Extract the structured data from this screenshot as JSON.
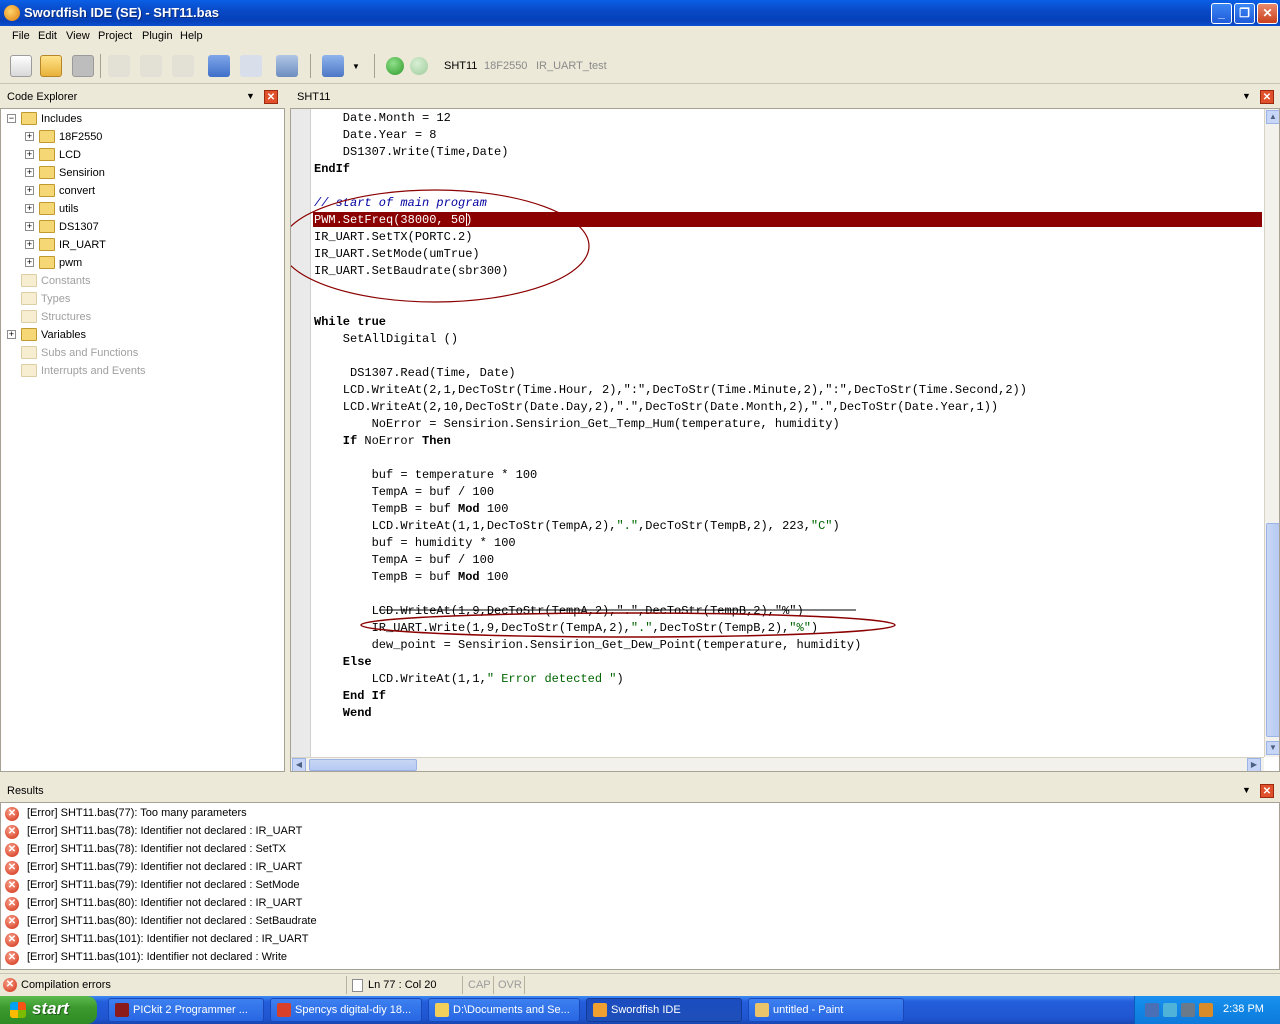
{
  "window": {
    "title": "Swordfish IDE (SE) - SHT11.bas"
  },
  "menu": [
    "File",
    "Edit",
    "View",
    "Project",
    "Plugin",
    "Help"
  ],
  "toolbar": {
    "tabs": [
      "SHT11",
      "18F2550",
      "IR_UART_test"
    ]
  },
  "explorer": {
    "title": "Code Explorer",
    "items": [
      {
        "label": "Includes",
        "level": 0,
        "expand": "−",
        "dim": false
      },
      {
        "label": "18F2550",
        "level": 1,
        "expand": "+",
        "dim": false
      },
      {
        "label": "LCD",
        "level": 1,
        "expand": "+",
        "dim": false
      },
      {
        "label": "Sensirion",
        "level": 1,
        "expand": "+",
        "dim": false
      },
      {
        "label": "convert",
        "level": 1,
        "expand": "+",
        "dim": false
      },
      {
        "label": "utils",
        "level": 1,
        "expand": "+",
        "dim": false
      },
      {
        "label": "DS1307",
        "level": 1,
        "expand": "+",
        "dim": false
      },
      {
        "label": "IR_UART",
        "level": 1,
        "expand": "+",
        "dim": false
      },
      {
        "label": "pwm",
        "level": 1,
        "expand": "+",
        "dim": false
      },
      {
        "label": "Constants",
        "level": 0,
        "expand": "",
        "dim": true
      },
      {
        "label": "Types",
        "level": 0,
        "expand": "",
        "dim": true
      },
      {
        "label": "Structures",
        "level": 0,
        "expand": "",
        "dim": true
      },
      {
        "label": "Variables",
        "level": 0,
        "expand": "+",
        "dim": false
      },
      {
        "label": "Subs and Functions",
        "level": 0,
        "expand": "",
        "dim": true
      },
      {
        "label": "Interrupts and Events",
        "level": 0,
        "expand": "",
        "dim": true
      }
    ]
  },
  "editor": {
    "tab": "SHT11",
    "lines": [
      [
        {
          "t": "    Date.Month = 12"
        }
      ],
      [
        {
          "t": "    Date.Year = 8"
        }
      ],
      [
        {
          "t": "    DS1307.Write(Time,Date)"
        }
      ],
      [
        {
          "t": "EndIf",
          "c": "kw"
        }
      ],
      [
        {
          "t": ""
        }
      ],
      [
        {
          "t": "// start of main program",
          "c": "cm"
        }
      ],
      [
        {
          "t": "PWM.SetFreq(38000, 50)",
          "c": "hl-text"
        }
      ],
      [
        {
          "t": "IR_UART.SetTX(PORTC.2)"
        }
      ],
      [
        {
          "t": "IR_UART.SetMode(umTrue)"
        }
      ],
      [
        {
          "t": "IR_UART.SetBaudrate(sbr300)"
        }
      ],
      [
        {
          "t": ""
        }
      ],
      [
        {
          "t": ""
        }
      ],
      [
        {
          "t": "While true",
          "c": "kw"
        }
      ],
      [
        {
          "t": "    SetAllDigital ()"
        }
      ],
      [
        {
          "t": ""
        }
      ],
      [
        {
          "t": "     DS1307.Read(Time, Date)"
        }
      ],
      [
        {
          "t": "    LCD.WriteAt(2,1,DecToStr(Time.Hour, 2),\":\",DecToStr(Time.Minute,2),\":\",DecToStr(Time.Second,2))"
        }
      ],
      [
        {
          "t": "    LCD.WriteAt(2,10,DecToStr(Date.Day,2),\".\",DecToStr(Date.Month,2),\".\",DecToStr(Date.Year,1))"
        }
      ],
      [
        {
          "t": "        NoError = Sensirion.Sensirion_Get_Temp_Hum(temperature, humidity)"
        }
      ],
      [
        {
          "t": "    If ",
          "c": "kw"
        },
        {
          "t": "NoError "
        },
        {
          "t": "Then",
          "c": "kw"
        }
      ],
      [
        {
          "t": ""
        }
      ],
      [
        {
          "t": "        buf = temperature * 100"
        }
      ],
      [
        {
          "t": "        TempA = buf / 100"
        }
      ],
      [
        {
          "t": "        TempB = buf "
        },
        {
          "t": "Mod",
          "c": "kw"
        },
        {
          "t": " 100"
        }
      ],
      [
        {
          "t": "        LCD.WriteAt(1,1,DecToStr(TempA,2),"
        },
        {
          "t": "\".\"",
          "c": "st"
        },
        {
          "t": ",DecToStr(TempB,2), 223,"
        },
        {
          "t": "\"C\"",
          "c": "st"
        },
        {
          "t": ")"
        }
      ],
      [
        {
          "t": "        buf = humidity * 100"
        }
      ],
      [
        {
          "t": "        TempA = buf / 100"
        }
      ],
      [
        {
          "t": "        TempB = buf "
        },
        {
          "t": "Mod",
          "c": "kw"
        },
        {
          "t": " 100"
        }
      ],
      [
        {
          "t": ""
        }
      ],
      [
        {
          "t": "        LCD.WriteAt(1,9,DecToStr(TempA,2),\".\",DecToStr(TempB,2),\"%\")"
        }
      ],
      [
        {
          "t": "        IR_UART.Write(1,9,DecToStr(TempA,2),"
        },
        {
          "t": "\".\"",
          "c": "st"
        },
        {
          "t": ",DecToStr(TempB,2),"
        },
        {
          "t": "\"%\"",
          "c": "st"
        },
        {
          "t": ")"
        }
      ],
      [
        {
          "t": "        dew_point = Sensirion.Sensirion_Get_Dew_Point(temperature, humidity)"
        }
      ],
      [
        {
          "t": "    Else",
          "c": "kw"
        }
      ],
      [
        {
          "t": "        LCD.WriteAt(1,1,"
        },
        {
          "t": "\" Error detected \"",
          "c": "st"
        },
        {
          "t": ")"
        }
      ],
      [
        {
          "t": "    End If",
          "c": "kw"
        }
      ],
      [
        {
          "t": "    Wend",
          "c": "kw"
        }
      ]
    ]
  },
  "results": {
    "title": "Results",
    "errors": [
      "[Error] SHT11.bas(77): Too many parameters",
      "[Error] SHT11.bas(78): Identifier not declared : IR_UART",
      "[Error] SHT11.bas(78): Identifier not declared : SetTX",
      "[Error] SHT11.bas(79): Identifier not declared : IR_UART",
      "[Error] SHT11.bas(79): Identifier not declared : SetMode",
      "[Error] SHT11.bas(80): Identifier not declared : IR_UART",
      "[Error] SHT11.bas(80): Identifier not declared : SetBaudrate",
      "[Error] SHT11.bas(101): Identifier not declared : IR_UART",
      "[Error] SHT11.bas(101): Identifier not declared : Write"
    ]
  },
  "status": {
    "message": "Compilation errors",
    "position": "Ln 77 : Col 20",
    "cap": "CAP",
    "ovr": "OVR"
  },
  "taskbar": {
    "start": "start",
    "tasks": [
      {
        "label": "PICkit 2 Programmer ...",
        "color": "#8B1A1A",
        "active": false
      },
      {
        "label": "Spencys digital-diy 18...",
        "color": "#D8402A",
        "active": false
      },
      {
        "label": "D:\\Documents and Se...",
        "color": "#F2CF5B",
        "active": false
      },
      {
        "label": "Swordfish IDE",
        "color": "#F0A030",
        "active": true
      },
      {
        "label": "untitled - Paint",
        "color": "#E9C46A",
        "active": false
      }
    ],
    "clock": "2:38 PM"
  },
  "colors": {
    "highlight": "#8B0000",
    "ellipse": "#8B0000"
  }
}
